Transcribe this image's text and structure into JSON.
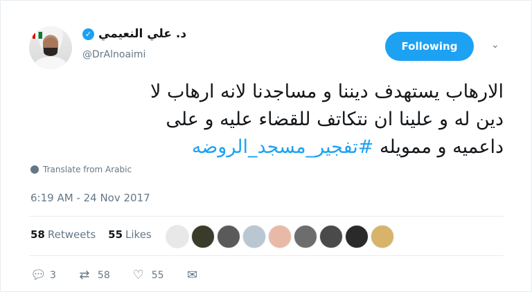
{
  "header": {
    "display_name": "د. علي النعيمي",
    "handle": "@DrAlnoaimi",
    "verified": true,
    "follow_label": "Following"
  },
  "tweet": {
    "text_line1": "الارهاب يستهدف ديننا و مساجدنا  لانه ارهاب لا",
    "text_line2": "دين له و علينا ان نتكاتف للقضاء عليه و على",
    "text_line3_plain": "داعميه و ممويله ",
    "hashtag": "#تفجير_مسجد_الروضه",
    "translate_label": "Translate from Arabic",
    "timestamp": "6:19 AM - 24 Nov 2017"
  },
  "stats": {
    "retweets_count": "58",
    "retweets_label": "Retweets",
    "likes_count": "55",
    "likes_label": "Likes",
    "liker_colors": [
      "#e8e8e8",
      "#3b3b2a",
      "#5a5a5a",
      "#b8c7d2",
      "#e9b9a8",
      "#6d6d6d",
      "#4a4a4a",
      "#2a2a2a",
      "#d8b36a"
    ]
  },
  "actions": {
    "reply_count": "3",
    "retweet_count": "58",
    "like_count": "55"
  },
  "colors": {
    "accent": "#1da1f2",
    "muted": "#657786"
  },
  "icons": [
    "verified-badge-icon",
    "chevron-down-icon",
    "globe-icon",
    "reply-icon",
    "retweet-icon",
    "like-icon",
    "message-icon"
  ]
}
